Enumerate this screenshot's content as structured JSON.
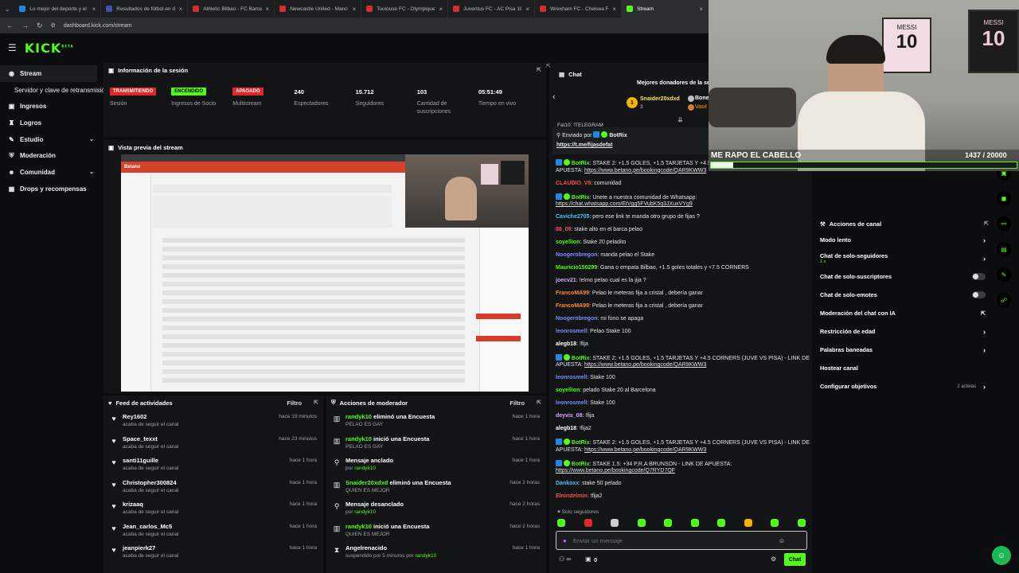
{
  "browser": {
    "tabs": [
      {
        "label": "Lo mejor del deporte y el entre",
        "color": "#1e88e5"
      },
      {
        "label": "Resultados de fútbol en directo",
        "color": "#3f51b5"
      },
      {
        "label": "Athletic Bilbao - FC Barcelona",
        "color": "#d32f2f"
      },
      {
        "label": "Newcastle United - Manchester",
        "color": "#d32f2f"
      },
      {
        "label": "Toulouse FC - Olympique Marse",
        "color": "#d32f2f"
      },
      {
        "label": "Juventus FC - AC Pisa 1909 Cuo",
        "color": "#d32f2f"
      },
      {
        "label": "Wrexham FC - Chelsea FC Cuot",
        "color": "#d32f2f"
      },
      {
        "label": "Stream",
        "color": "#53fc18"
      }
    ],
    "url": "dashboard.kick.com/stream"
  },
  "brand": {
    "logo": "KICK",
    "beta": "BETA",
    "accent": "#53fc18"
  },
  "sidebar": {
    "items": [
      {
        "label": "Stream",
        "icon": "broadcast-icon",
        "glyph": "◉",
        "active": true
      },
      {
        "label": "Servidor y clave de retransmisión",
        "sub": true
      },
      {
        "label": "Ingresos",
        "icon": "money-icon",
        "glyph": "▣"
      },
      {
        "label": "Logros",
        "icon": "trophy-icon",
        "glyph": "♜"
      },
      {
        "label": "Estudio",
        "icon": "studio-icon",
        "glyph": "✎",
        "chevron": true
      },
      {
        "label": "Moderación",
        "icon": "shield-icon",
        "glyph": "⛨"
      },
      {
        "label": "Comunidad",
        "icon": "people-icon",
        "glyph": "☻",
        "chevron": true
      },
      {
        "label": "Drops y recompensas",
        "icon": "gift-icon",
        "glyph": "▦"
      }
    ]
  },
  "session": {
    "title": "Información de la sesión",
    "stats": [
      {
        "value": "TRANSMITIENDO",
        "label": "Sesión",
        "badge": "red"
      },
      {
        "value": "ENCENDIDO",
        "label": "Ingresos de Socio",
        "badge": "green"
      },
      {
        "value": "APAGADO",
        "label": "Multistream",
        "badge": "red"
      },
      {
        "value": "240",
        "label": "Espectadores"
      },
      {
        "value": "15.712",
        "label": "Seguidores"
      },
      {
        "value": "103",
        "label": "Cantidad de suscripciones"
      },
      {
        "value": "05:51:49",
        "label": "Tiempo en vivo"
      }
    ]
  },
  "preview": {
    "title": "Vista previa del stream",
    "betano": "Betano"
  },
  "activity": {
    "title": "Feed de actividades",
    "filter": "Filtro",
    "items": [
      {
        "name": "Rey1602",
        "sub": "acaba de seguir el canal",
        "time": "hace 19 minutos"
      },
      {
        "name": "Space_texxt",
        "sub": "acaba de seguir el canal",
        "time": "hace 23 minutos"
      },
      {
        "name": "santi11guille",
        "sub": "acaba de seguir el canal",
        "time": "hace 1 hora"
      },
      {
        "name": "Christopher300824",
        "sub": "acaba de seguir el canal",
        "time": "hace 1 hora"
      },
      {
        "name": "krizaaq",
        "sub": "acaba de seguir el canal",
        "time": "hace 1 hora"
      },
      {
        "name": "Jean_carlos_Mc5",
        "sub": "acaba de seguir el canal",
        "time": "hace 1 hora"
      },
      {
        "name": "jeanpierk27",
        "sub": "acaba de seguir el canal",
        "time": "hace 1 hora"
      }
    ]
  },
  "modactions": {
    "title": "Acciones de moderador",
    "filter": "Filtro",
    "items": [
      {
        "actor": "randyk10",
        "action": " eliminó una Encuesta",
        "sub": "PELAO ES GAY",
        "time": "hace 1 hora",
        "glyph": "▥"
      },
      {
        "actor": "randyk10",
        "action": " inició una Encuesta",
        "sub": "PELAO ES GAY",
        "time": "hace 1 hora",
        "glyph": "▥"
      },
      {
        "actor": "",
        "action": "Mensaje anclado",
        "sub": "por ",
        "subuser": "randyk10",
        "time": "hace 1 hora",
        "glyph": "⚲"
      },
      {
        "actor": "Snaider20xdxd",
        "action": " eliminó una Encuesta",
        "sub": "QUIEN ES MEJOR",
        "time": "hace 2 horas",
        "glyph": "▥"
      },
      {
        "actor": "",
        "action": "Mensaje desanclado",
        "sub": "por ",
        "subuser": "randyk10",
        "time": "hace 2 horas",
        "glyph": "⚲"
      },
      {
        "actor": "randyk10",
        "action": " inició una Encuesta",
        "sub": "QUIEN ES MEJOR",
        "time": "hace 2 horas",
        "glyph": "▥"
      },
      {
        "actor": "",
        "action": "Angelrenacido",
        "sub": "suspendido por 5 minutos por ",
        "subuser": "randyk10",
        "time": "hace 1 hora",
        "glyph": "⧗"
      }
    ]
  },
  "chat": {
    "title": "Chat",
    "donors_title": "Mejores donadores de la se",
    "donor1": "Snaider20xdxd",
    "donor1_count": "3",
    "donor2": "Bones",
    "donor3": "Vasil",
    "pinned_partial": "Fat10: !TELEGRAM",
    "sent_by": "Enviado por",
    "sent_by_user": "BotRix",
    "pinned_link": "https://t.me/fijasdefat",
    "messages": [
      {
        "user": "BotRix",
        "color": "#53fc18",
        "bot": true,
        "text": ": STAKE 2: +1.5 GOLES, +1.5 TARJETAS Y +4.5 CORNERS (JUVE VS PISA) - LINK DE APUESTA: ",
        "link": "https://www.betano.pe/bookingcode/QAR9KWW3"
      },
      {
        "user": "CLAUDIO_V8",
        "color": "#ff4d4d",
        "text": ": comunidad"
      },
      {
        "user": "BotRix",
        "color": "#53fc18",
        "bot": true,
        "text": ": Unete a nuestra comunidad de Whatsapp: ",
        "link": "https://chat.whatsapp.com/EtVgg5FVubK5q3JXuxVYg9"
      },
      {
        "user": "Caviche2705",
        "color": "#4fc3f7",
        "text": ": pero ese link te manda otro grupo de fijas ?"
      },
      {
        "user": "88_06",
        "color": "#ff4d4d",
        "text": ": stake alto en el barca pelao"
      },
      {
        "user": "soyellion",
        "color": "#53fc18",
        "text": ": Stake 20 peladito"
      },
      {
        "user": "Noogerobregon",
        "color": "#7c8cff",
        "text": ": manda pelao el Stake"
      },
      {
        "user": "Mauricio150299",
        "color": "#53fc18",
        "text": ": Gana o empata Bilbao, +1.5 goles totales y +7.5 CORNERS"
      },
      {
        "user": "joecv21",
        "color": "#d7a8ff",
        "text": ": !elmo pelao cual es la jija ?"
      },
      {
        "user": "FrancoMA99",
        "color": "#ff8a3d",
        "text": ": Pelao le meteras fija a cristal , debería ganar"
      },
      {
        "user": "FrancoMA99",
        "color": "#ff8a3d",
        "text": ": Pelao le meteras fija a cristal , debería ganar"
      },
      {
        "user": "Noogerobregon",
        "color": "#7c8cff",
        "text": ": mi fono se apaga"
      },
      {
        "user": "leonrosmell",
        "color": "#7c8cff",
        "text": ": Pelao Stake 100"
      },
      {
        "user": "alegb18",
        "color": "#ffffff",
        "text": ": !fija"
      },
      {
        "user": "BotRix",
        "color": "#53fc18",
        "bot": true,
        "text": ": STAKE 2: +1.5 GOLES, +1.5 TARJETAS Y +4.5 CORNERS (JUVE VS PISA) - LINK DE APUESTA: ",
        "link": "https://www.betano.pe/bookingcode/QAR9KWW3"
      },
      {
        "user": "leonrosmell",
        "color": "#7c8cff",
        "text": ": Stake 100"
      },
      {
        "user": "soyellion",
        "color": "#53fc18",
        "text": ": pelado Stake 20 al Barcelona"
      },
      {
        "user": "leonrosmell",
        "color": "#7c8cff",
        "text": ": Stake 100"
      },
      {
        "user": "deyvis_08",
        "color": "#d7a8ff",
        "text": ": !fija"
      },
      {
        "user": "alegb18",
        "color": "#ffffff",
        "text": ": !fija2"
      },
      {
        "user": "BotRix",
        "color": "#53fc18",
        "bot": true,
        "text": ": STAKE 2: +1.5 GOLES, +1.5 TARJETAS Y +4.5 CORNERS (JUVE VS PISA) - LINK DE APUESTA: ",
        "link": "https://www.betano.pe/bookingcode/QAR9KWW3"
      },
      {
        "user": "BotRix",
        "color": "#53fc18",
        "bot": true,
        "text": ": STAKE 1.5: +34 P,R,A BRUNSON - LINK DE APUESTA: ",
        "link": "https://www.betano.pe/bookingcode/Q7RYD7QF"
      },
      {
        "user": "Dankoxx",
        "color": "#4fc3f7",
        "text": ": stake 50 pelado"
      },
      {
        "user": "Elnindelmin",
        "color": "#ff4d4d",
        "text": ": !fija2"
      }
    ],
    "followers_only": "Solo seguidores",
    "input_placeholder": "Enviar un mensaje",
    "points": "0",
    "send_label": "Chat"
  },
  "channel_actions": {
    "title": "Acciones de canal",
    "rows": [
      {
        "label": "Modo lento",
        "control": "arrow"
      },
      {
        "label": "Chat de solo-seguidores",
        "sub": "1 s",
        "control": "arrow"
      },
      {
        "label": "Chat de solo-suscriptores",
        "control": "toggle"
      },
      {
        "label": "Chat de solo-emotes",
        "control": "toggle"
      },
      {
        "label": "Moderación del chat con IA",
        "control": "ext"
      },
      {
        "label": "Restricción de edad",
        "control": "arrow"
      },
      {
        "label": "Palabras baneadas",
        "control": "arrow"
      },
      {
        "label": "Hostear canal",
        "control": "none"
      },
      {
        "label": "Configurar objetivos",
        "control": "arrow",
        "extra": "2 activas"
      }
    ]
  },
  "webcam": {
    "caption": "ME RAPO EL CABELLO",
    "progress_current": "1437",
    "progress_total": "/ 20000",
    "progress_fraction": 0.0719,
    "poster_text": "MESSI",
    "poster_number": "10"
  }
}
